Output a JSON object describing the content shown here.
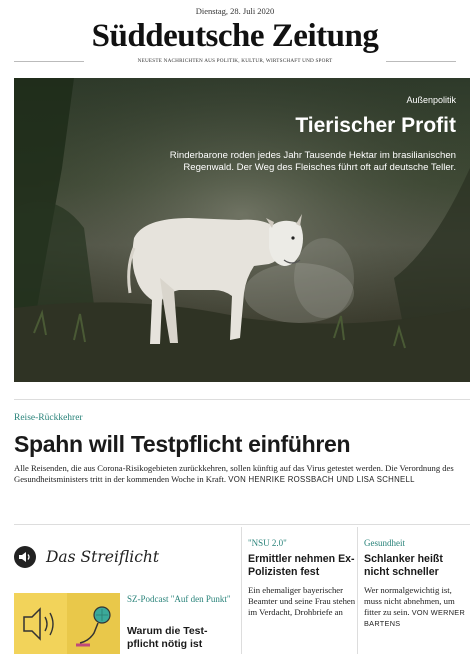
{
  "header": {
    "date": "Dienstag, 28. Juli 2020",
    "masthead": "Süddeutsche Zeitung",
    "tagline": "NEUESTE NACHRICHTEN AUS POLITIK, KULTUR, WIRTSCHAFT UND SPORT"
  },
  "hero": {
    "kicker": "Außenpolitik",
    "title": "Tierischer Profit",
    "teaser": "Rinderbarone roden jedes Jahr Tausende Hektar im brasilianischen Regenwald. Der Weg des Fleisches führt oft auf deutsche Teller."
  },
  "main_story": {
    "kicker": "Reise-Rückkehrer",
    "title": "Spahn will Testpflicht einführen",
    "teaser": "Alle Reisenden, die aus Corona-Risikogebieten zurückkehren, sollen künftig auf das Virus getestet werden. Die Verordnung des Gesundheitsministers tritt in der kommenden Woche in Kraft.",
    "author": "VON HENRIKE ROSSBACH UND LISA SCHNELL"
  },
  "streiflicht": {
    "title": "Das Streiflicht",
    "icon": "speaker-icon"
  },
  "podcast": {
    "kicker": "SZ-Podcast \"Auf den Punkt\"",
    "title": "Warum die Test-pflicht nötig ist"
  },
  "column_nsu": {
    "kicker": "\"NSU 2.0\"",
    "title": "Ermittler nehmen Ex-Polizisten fest",
    "teaser": "Ein ehemaliger bayerischer Beamter und seine Frau stehen im Verdacht, Drohbriefe an"
  },
  "column_health": {
    "kicker": "Gesundheit",
    "title": "Schlanker heißt nicht schneller",
    "teaser": "Wer normalgewichtig ist, muss nicht abnehmen, um fitter zu sein.",
    "author": "VON WERNER BARTENS"
  },
  "colors": {
    "kicker": "#29837a",
    "podcast_bg": "#f2d35a"
  }
}
